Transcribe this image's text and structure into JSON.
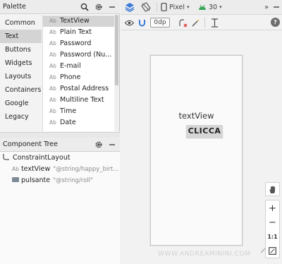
{
  "palette": {
    "title": "Palette",
    "categories": [
      "Common",
      "Text",
      "Buttons",
      "Widgets",
      "Layouts",
      "Containers",
      "Google",
      "Legacy"
    ],
    "selected_category": "Text",
    "item_icon_text": "Ab",
    "items": [
      "TextView",
      "Plain Text",
      "Password",
      "Password (Nu...",
      "E-mail",
      "Phone",
      "Postal Address",
      "Multiline Text",
      "Time",
      "Date"
    ],
    "selected_item": "TextView"
  },
  "component_tree": {
    "title": "Component Tree",
    "root": "ConstraintLayout",
    "children": [
      {
        "name": "textView",
        "hint": "\"@string/happy_birt..."
      },
      {
        "name": "pulsante",
        "hint": "\"@string/roll\""
      }
    ]
  },
  "toolbar": {
    "device": "Pixel",
    "api_level": "30",
    "margin": "0dp"
  },
  "canvas": {
    "textview_text": "textView",
    "button_text": "CLICCA",
    "watermark": "WWW.ANDREAMININI.COM"
  },
  "zoom": {
    "plus": "+",
    "minus": "−",
    "one_to_one": "1:1"
  }
}
